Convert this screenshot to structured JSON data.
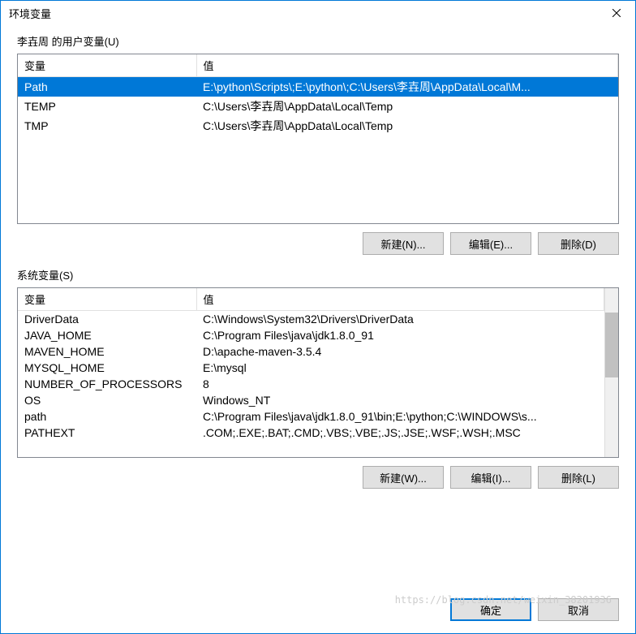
{
  "titlebar": {
    "title": "环境变量"
  },
  "user_section": {
    "label": "李壵周 的用户变量(U)",
    "headers": {
      "name": "变量",
      "value": "值"
    },
    "rows": [
      {
        "name": "Path",
        "value": "E:\\python\\Scripts\\;E:\\python\\;C:\\Users\\李壵周\\AppData\\Local\\M...",
        "selected": true
      },
      {
        "name": "TEMP",
        "value": "C:\\Users\\李壵周\\AppData\\Local\\Temp",
        "selected": false
      },
      {
        "name": "TMP",
        "value": "C:\\Users\\李壵周\\AppData\\Local\\Temp",
        "selected": false
      }
    ],
    "buttons": {
      "new": "新建(N)...",
      "edit": "编辑(E)...",
      "delete": "删除(D)"
    }
  },
  "system_section": {
    "label": "系统变量(S)",
    "headers": {
      "name": "变量",
      "value": "值"
    },
    "rows": [
      {
        "name": "DriverData",
        "value": "C:\\Windows\\System32\\Drivers\\DriverData"
      },
      {
        "name": "JAVA_HOME",
        "value": "C:\\Program Files\\java\\jdk1.8.0_91"
      },
      {
        "name": "MAVEN_HOME",
        "value": "D:\\apache-maven-3.5.4"
      },
      {
        "name": "MYSQL_HOME",
        "value": "E:\\mysql"
      },
      {
        "name": "NUMBER_OF_PROCESSORS",
        "value": "8"
      },
      {
        "name": "OS",
        "value": "Windows_NT"
      },
      {
        "name": "path",
        "value": "C:\\Program Files\\java\\jdk1.8.0_91\\bin;E:\\python;C:\\WINDOWS\\s..."
      },
      {
        "name": "PATHEXT",
        "value": ".COM;.EXE;.BAT;.CMD;.VBS;.VBE;.JS;.JSE;.WSF;.WSH;.MSC"
      }
    ],
    "buttons": {
      "new": "新建(W)...",
      "edit": "编辑(I)...",
      "delete": "删除(L)"
    }
  },
  "dialog_buttons": {
    "ok": "确定",
    "cancel": "取消"
  },
  "watermark": "https://blog.csdn.net/weixin_38201936"
}
